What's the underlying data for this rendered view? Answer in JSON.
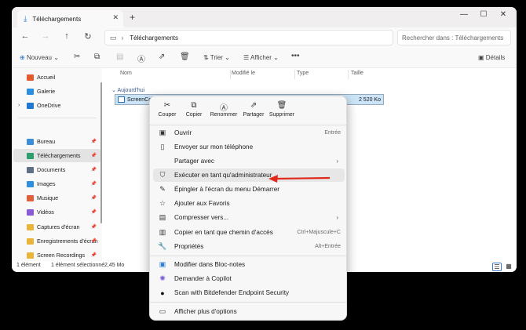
{
  "tab": {
    "title": "Téléchargements",
    "close": "✕",
    "new": "+"
  },
  "window_controls": {
    "minimize": "—",
    "maximize": "☐",
    "close": "✕"
  },
  "address": {
    "location": "Téléchargements",
    "chevron": "›"
  },
  "search": {
    "placeholder": "Rechercher dans : Téléchargements"
  },
  "toolbar": {
    "new_label": "Nouveau",
    "sort_label": "Trier",
    "view_label": "Afficher",
    "more": "•••",
    "details_label": "Détails"
  },
  "sidebar": {
    "items": [
      {
        "label": "Accueil",
        "color": "#e35a2c"
      },
      {
        "label": "Galerie",
        "color": "#2a8fe0"
      },
      {
        "label": "OneDrive",
        "color": "#1f78d1"
      },
      {
        "label": "Bureau",
        "color": "#3b8fd9"
      },
      {
        "label": "Téléchargements",
        "color": "#2f9e6f"
      },
      {
        "label": "Documents",
        "color": "#5f6f86"
      },
      {
        "label": "Images",
        "color": "#2d8fdd"
      },
      {
        "label": "Musique",
        "color": "#e0603b"
      },
      {
        "label": "Vidéos",
        "color": "#8a5bd6"
      },
      {
        "label": "Captures d'écran",
        "color": "#e8b53a"
      },
      {
        "label": "Enregistrements d'écran",
        "color": "#e8b53a"
      },
      {
        "label": "Screen Recordings",
        "color": "#e8b53a"
      }
    ]
  },
  "columns": {
    "name": "Nom",
    "modified": "Modifié le",
    "type": "Type",
    "size": "Taille"
  },
  "group": {
    "label": "Aujourd'hui"
  },
  "file": {
    "name": "ScreenCon",
    "size": "2 520 Ko"
  },
  "status": {
    "count": "1 élément",
    "selected": "1 élément sélectionné",
    "size": "2,45 Mo"
  },
  "context_menu": {
    "quick_actions": [
      {
        "label": "Couper",
        "icon": "cut-icon"
      },
      {
        "label": "Copier",
        "icon": "copy-icon"
      },
      {
        "label": "Renommer",
        "icon": "rename-icon"
      },
      {
        "label": "Partager",
        "icon": "share-icon"
      },
      {
        "label": "Supprimer",
        "icon": "delete-icon"
      }
    ],
    "items": [
      {
        "label": "Ouvrir",
        "shortcut": "Entrée"
      },
      {
        "label": "Envoyer sur mon téléphone",
        "shortcut": ""
      },
      {
        "label": "Partager avec",
        "shortcut": ""
      },
      {
        "label": "Exécuter en tant qu'administrateur",
        "shortcut": ""
      },
      {
        "label": "Épingler à l'écran du menu Démarrer",
        "shortcut": ""
      },
      {
        "label": "Ajouter aux Favoris",
        "shortcut": ""
      },
      {
        "label": "Compresser vers...",
        "shortcut": ""
      },
      {
        "label": "Copier en tant que chemin d'accès",
        "shortcut": "Ctrl+Majuscule+C"
      },
      {
        "label": "Propriétés",
        "shortcut": "Alt+Entrée"
      },
      {
        "label": "Modifier dans Bloc-notes",
        "shortcut": ""
      },
      {
        "label": "Demander à Copilot",
        "shortcut": ""
      },
      {
        "label": "Scan with Bitdefender Endpoint Security",
        "shortcut": ""
      },
      {
        "label": "Afficher plus d'options",
        "shortcut": ""
      }
    ]
  },
  "colors": {
    "accent": "#1d6fd1",
    "arrow": "#e0281c",
    "selection": "#cce4f7"
  }
}
